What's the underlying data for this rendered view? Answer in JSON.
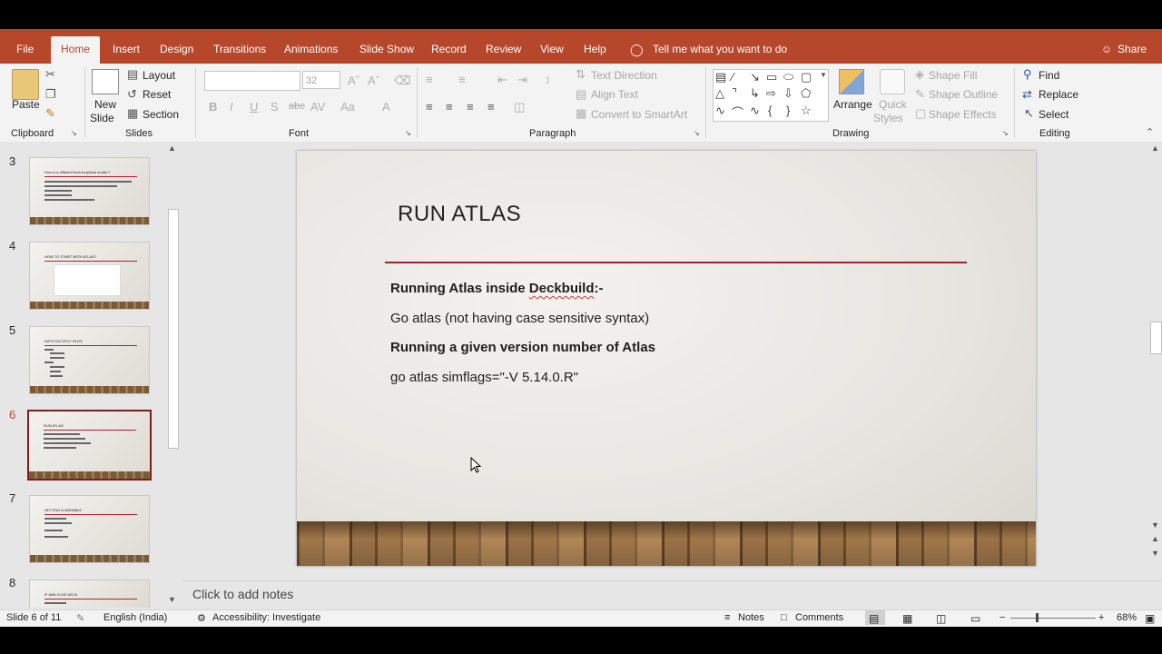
{
  "tabs": {
    "file": "File",
    "home": "Home",
    "insert": "Insert",
    "design": "Design",
    "transitions": "Transitions",
    "animations": "Animations",
    "slideshow": "Slide Show",
    "record": "Record",
    "review": "Review",
    "view": "View",
    "help": "Help",
    "tellme": "Tell me what you want to do",
    "share": "Share"
  },
  "ribbon": {
    "clipboard": {
      "paste": "Paste",
      "label": "Clipboard"
    },
    "slides": {
      "new_slide_1": "New",
      "new_slide_2": "Slide",
      "layout": "Layout",
      "reset": "Reset",
      "section": "Section",
      "label": "Slides"
    },
    "font": {
      "font_name": "",
      "font_size": "32",
      "label": "Font"
    },
    "paragraph": {
      "text_direction": "Text Direction",
      "align_text": "Align Text",
      "convert_smartart": "Convert to SmartArt",
      "label": "Paragraph"
    },
    "drawing": {
      "arrange": "Arrange",
      "quick_styles_1": "Quick",
      "quick_styles_2": "Styles",
      "shape_fill": "Shape Fill",
      "shape_outline": "Shape Outline",
      "shape_effects": "Shape Effects",
      "label": "Drawing"
    },
    "editing": {
      "find": "Find",
      "replace": "Replace",
      "select": "Select",
      "label": "Editing"
    }
  },
  "thumbnails": [
    {
      "num": "3",
      "title": "How is a different from empirical model ?"
    },
    {
      "num": "4",
      "title": "HOW TO START WITH ATLAS?"
    },
    {
      "num": "5",
      "title": "INPUT/OUTPUT FILES"
    },
    {
      "num": "6",
      "title": "RUN ATLAS"
    },
    {
      "num": "7",
      "title": "SETTING A VARIABLE"
    },
    {
      "num": "8",
      "title": "IF AND ELSE DECK"
    }
  ],
  "slide": {
    "title": "RUN ATLAS",
    "lines": [
      {
        "text_a": "Running Atlas inside ",
        "text_b": "Deckbuild",
        "text_c": ":-"
      },
      {
        "text": "Go atlas (not having case sensitive syntax)"
      },
      {
        "text": "Running a given version number of Atlas"
      },
      {
        "text": "go atlas simflags=\"-V 5.14.0.R\""
      }
    ]
  },
  "notes_placeholder": "Click to add notes",
  "status": {
    "slide_count": "Slide 6 of 11",
    "language": "English (India)",
    "accessibility": "Accessibility: Investigate",
    "notes": "Notes",
    "comments": "Comments",
    "zoom": "68%"
  },
  "colors": {
    "accent": "#b7472a",
    "slide_rule": "#a3202c",
    "selected_thumb": "#7b1e1e"
  }
}
